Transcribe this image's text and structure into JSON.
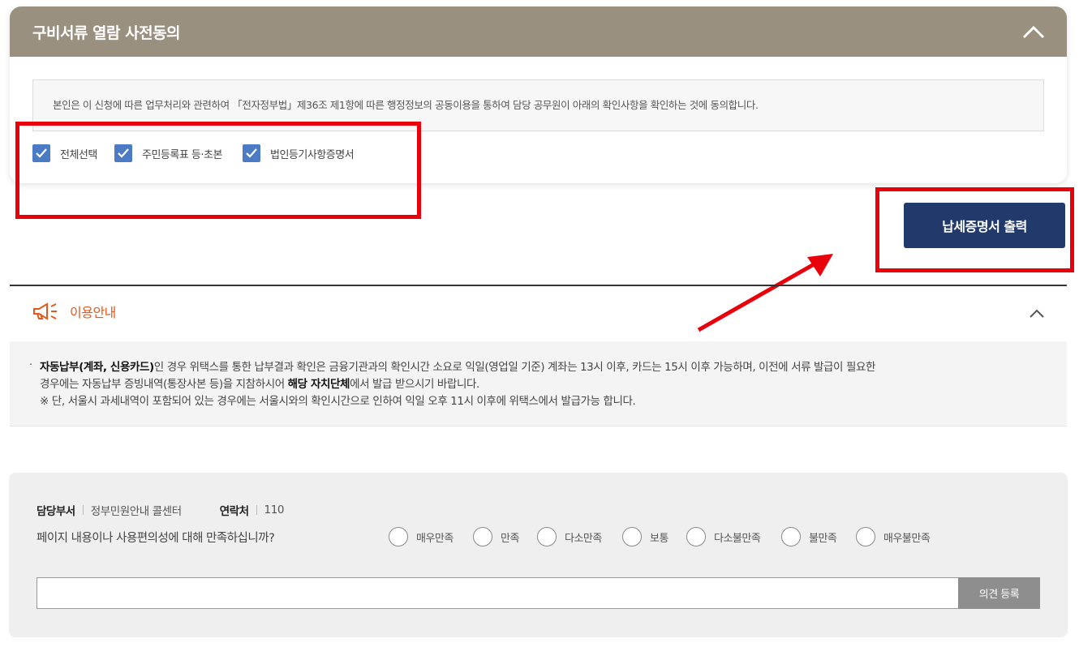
{
  "consent": {
    "title": "구비서류 열람 사전동의",
    "notice": "본인은 이 신청에 따른 업무처리와 관련하여 「전자정부법」제36조 제1항에 따른 행정정보의 공동이용을 통하여 담당 공무원이 아래의 확인사항을 확인하는 것에 동의합니다.",
    "checkboxes": [
      {
        "label": "전체선택",
        "checked": true
      },
      {
        "label": "주민등록표 등·초본",
        "checked": true
      },
      {
        "label": "법인등기사항증명서",
        "checked": true
      }
    ]
  },
  "print_button": "납세증명서 출력",
  "usage": {
    "title": "이용안내",
    "bullet": "·",
    "line1_bold": "자동납부(계좌, 신용카드)",
    "line1_rest": "인 경우 위택스를 통한 납부결과 확인은 금융기관과의 확인시간 소요로 익일(영업일 기준) 계좌는 13시 이후, 카드는 15시 이후 가능하며, 이전에 서류 발급이 필요한",
    "line2_pre": "경우에는 자동납부 증빙내역(통장사본 등)을 지참하시어 ",
    "line2_bold": "해당 자치단체",
    "line2_post": "에서 발급 받으시기 바랍니다.",
    "line3": "※ 단, 서울시 과세내역이 포함되어 있는 경우에는 서울시와의 확인시간으로 인하여 익일 오후 11시 이후에 위택스에서 발급가능 합니다."
  },
  "feedback": {
    "dept_label": "담당부서",
    "dept_value": "정부민원안내 콜센터",
    "contact_label": "연락처",
    "contact_value": "110",
    "question": "페이지 내용이나 사용편의성에 대해 만족하십니까?",
    "ratings": [
      "매우만족",
      "만족",
      "다소만족",
      "보통",
      "다소불만족",
      "불만족",
      "매우불만족"
    ],
    "submit": "의견 등록"
  },
  "colors": {
    "header": "#9a9080",
    "checkbox": "#4a7bc4",
    "print_button": "#213a6b",
    "accent_orange": "#e05a1e",
    "annotation_red": "#e8000b"
  }
}
